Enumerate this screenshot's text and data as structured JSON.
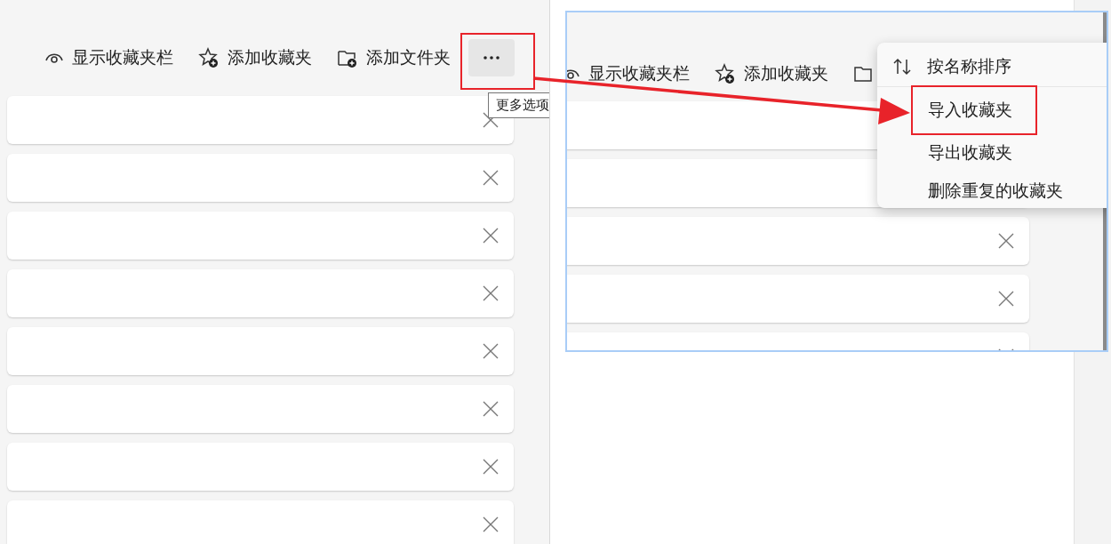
{
  "left_panel": {
    "toolbar": [
      {
        "label": "显示收藏夹栏",
        "kind": "eye"
      },
      {
        "label": "添加收藏夹",
        "kind": "star"
      },
      {
        "label": "添加文件夹",
        "kind": "folder"
      }
    ],
    "more_button": {
      "annotated": true
    },
    "tooltip": "更多选项",
    "rows": [
      {
        "kind": "favorite"
      },
      {
        "kind": "favorite"
      },
      {
        "kind": "favorite"
      },
      {
        "kind": "favorite"
      },
      {
        "kind": "favorite"
      },
      {
        "kind": "favorite"
      },
      {
        "kind": "favorite"
      },
      {
        "kind": "favorite"
      }
    ]
  },
  "inset": {
    "toolbar": [
      {
        "label": "显示收藏夹栏",
        "kind": "eye"
      },
      {
        "label": "添加收藏夹",
        "kind": "star"
      },
      {
        "kind": "folder"
      }
    ],
    "rows": [
      {
        "kind": "favorite"
      },
      {
        "kind": "favorite"
      },
      {
        "kind": "favorite"
      },
      {
        "kind": "favorite"
      },
      {
        "kind": "favorite"
      }
    ],
    "menu": [
      {
        "label": "按名称排序",
        "kind": "sort",
        "annotated": false
      },
      {
        "label": "导入收藏夹",
        "kind": "plain",
        "annotated": true
      },
      {
        "label": "导出收藏夹",
        "kind": "plain",
        "annotated": false
      },
      {
        "label": "删除重复的收藏夹",
        "kind": "plain",
        "annotated": false
      }
    ]
  }
}
